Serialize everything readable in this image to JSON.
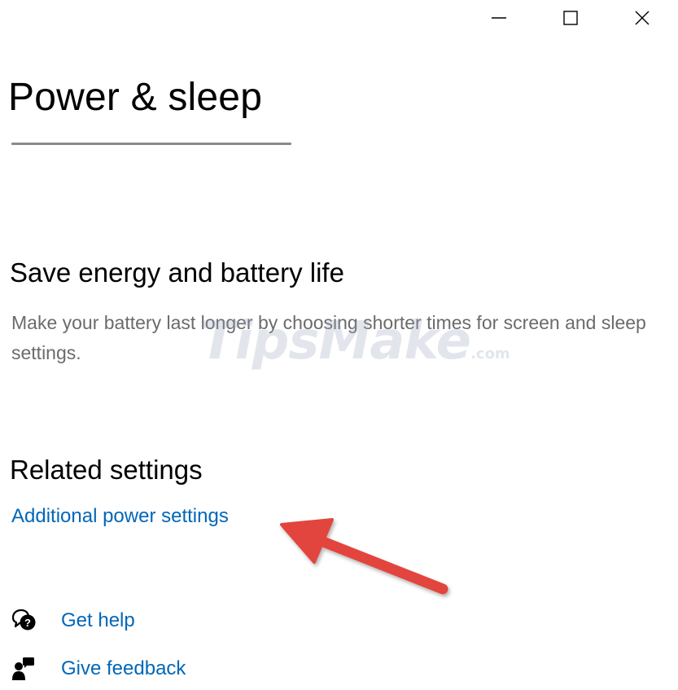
{
  "window": {
    "controls": {
      "minimize_icon": "minimize-icon",
      "maximize_icon": "maximize-icon",
      "close_icon": "close-icon"
    }
  },
  "page": {
    "title": "Power & sleep"
  },
  "save_energy": {
    "heading": "Save energy and battery life",
    "description": "Make your battery last longer by choosing shorter times for screen and sleep settings."
  },
  "watermark": {
    "text": "TipsMake",
    "suffix": ".com"
  },
  "related_settings": {
    "heading": "Related settings",
    "link_label": "Additional power settings"
  },
  "help": {
    "get_help": {
      "label": "Get help",
      "icon": "get-help-icon"
    },
    "give_feedback": {
      "label": "Give feedback",
      "icon": "give-feedback-icon"
    }
  },
  "colors": {
    "link": "#0067b8",
    "description": "#6b6b6b",
    "annotation_arrow": "#e2453c",
    "title_rule": "#8a8a8a"
  }
}
